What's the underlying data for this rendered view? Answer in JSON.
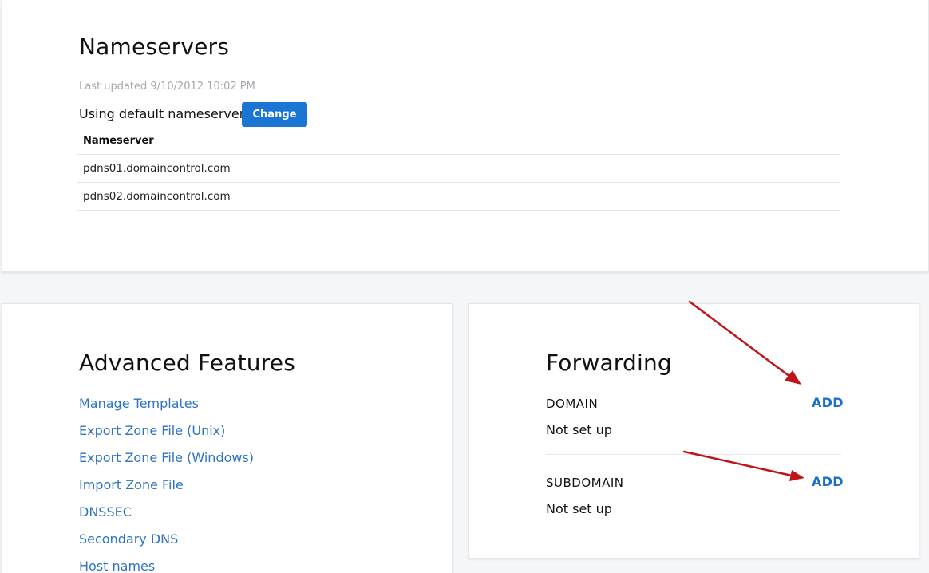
{
  "nameservers": {
    "title": "Nameservers",
    "last_updated": "Last updated 9/10/2012 10:02 PM",
    "status_text": "Using default nameservers",
    "change_label": "Change",
    "table_header": "Nameserver",
    "rows": [
      "pdns01.domaincontrol.com",
      "pdns02.domaincontrol.com"
    ]
  },
  "advanced": {
    "title": "Advanced Features",
    "links": [
      "Manage Templates",
      "Export Zone File (Unix)",
      "Export Zone File (Windows)",
      "Import Zone File",
      "DNSSEC",
      "Secondary DNS",
      "Host names"
    ]
  },
  "forwarding": {
    "title": "Forwarding",
    "domain": {
      "label": "DOMAIN",
      "status": "Not set up",
      "action": "ADD"
    },
    "subdomain": {
      "label": "SUBDOMAIN",
      "status": "Not set up",
      "action": "ADD"
    }
  },
  "colors": {
    "accent": "#1a76d2",
    "link": "#2e73c4",
    "annotation_arrow": "#c0141b",
    "page_background": "#f5f6f8"
  }
}
